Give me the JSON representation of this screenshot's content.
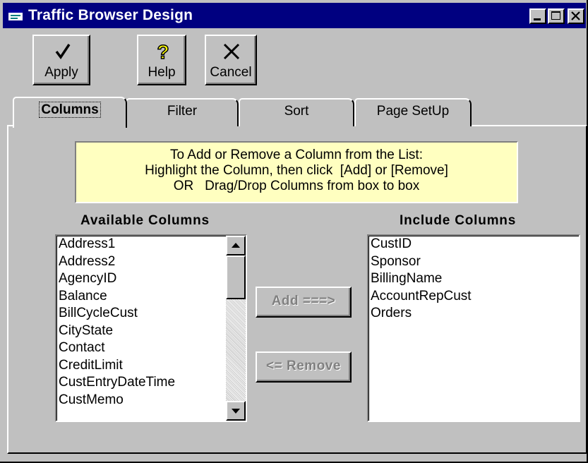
{
  "window": {
    "title": "Traffic Browser Design"
  },
  "toolbar": {
    "apply_label": "Apply",
    "help_label": "Help",
    "cancel_label": "Cancel"
  },
  "tabs": [
    {
      "label": "Columns"
    },
    {
      "label": "Filter"
    },
    {
      "label": "Sort"
    },
    {
      "label": "Page SetUp"
    }
  ],
  "info": {
    "line1": "To Add or Remove a Column from the List:",
    "line2": "Highlight the Column, then click  [Add] or [Remove]",
    "line3": "OR   Drag/Drop Columns from box to box"
  },
  "available": {
    "header": "Available Columns",
    "items": [
      "Address1",
      "Address2",
      "AgencyID",
      "Balance",
      "BillCycleCust",
      "CityState",
      "Contact",
      "CreditLimit",
      "CustEntryDateTime",
      "CustMemo"
    ]
  },
  "include": {
    "header": "Include Columns",
    "items": [
      "CustID",
      "Sponsor",
      "BillingName",
      "AccountRepCust",
      "Orders"
    ]
  },
  "buttons": {
    "add_label": "Add  ===>",
    "remove_label": "<= Remove"
  },
  "colors": {
    "titlebar": "#000080",
    "face": "#c0c0c0",
    "info_bg": "#ffffc0",
    "disabled_text": "#808080"
  }
}
